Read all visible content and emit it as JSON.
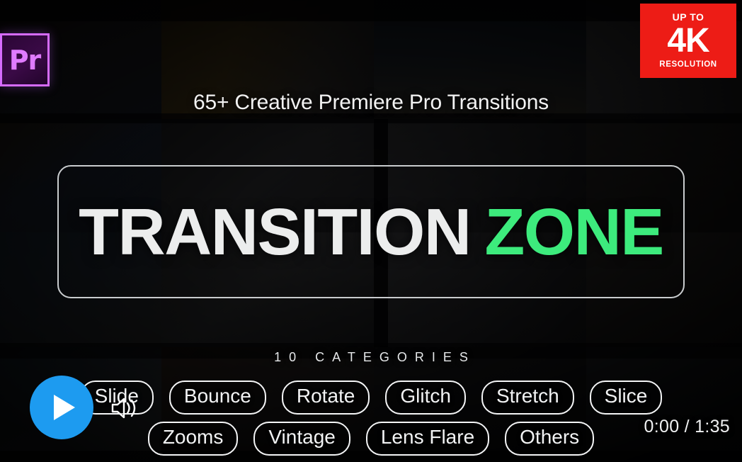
{
  "branding": {
    "premiere_logo_text": "Pr",
    "premiere_logo_icon": "premiere-pro-logo-icon"
  },
  "badge": {
    "line1": "UP TO",
    "line2": "4K",
    "line3": "RESOLUTION",
    "color": "#ed1c16"
  },
  "subtitle": "65+ Creative Premiere Pro Transitions",
  "title": {
    "main": "TRANSITION",
    "accent": "ZONE",
    "accent_color": "#3deb7d",
    "main_color": "#eceded"
  },
  "categories": {
    "label": "10 CATEGORIES",
    "row1": [
      {
        "label": "Slide"
      },
      {
        "label": "Bounce"
      },
      {
        "label": "Rotate"
      },
      {
        "label": "Glitch"
      },
      {
        "label": "Stretch"
      },
      {
        "label": "Slice"
      }
    ],
    "row2": [
      {
        "label": "Zooms"
      },
      {
        "label": "Vintage"
      },
      {
        "label": "Lens Flare"
      },
      {
        "label": "Others"
      }
    ]
  },
  "player": {
    "play_icon": "play-icon",
    "play_color": "#1d9bf0",
    "cursor_icon": "volume-speaker-cursor-icon",
    "time_current": "0:00",
    "time_total": "1:35",
    "time_display": "0:00 / 1:35"
  }
}
